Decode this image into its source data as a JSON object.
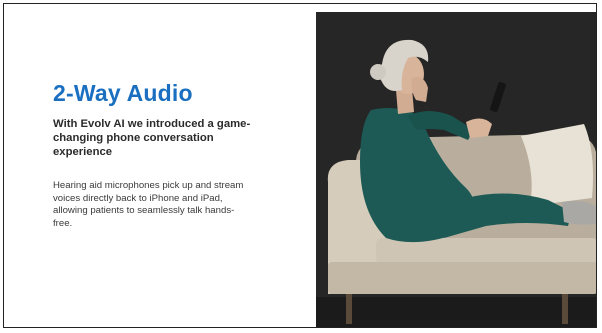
{
  "slide": {
    "title": "2-Way Audio",
    "subtitle": "With Evolv AI we introduced a game-changing phone conversation experience",
    "body": "Hearing aid microphones pick up and stream voices directly back to iPhone and iPad, allowing patients to seamlessly talk hands-free."
  },
  "colors": {
    "title": "#1a6fc0",
    "photo_background": "#262626",
    "sofa": "#cfc5b5",
    "outfit": "#1d5a55",
    "hair": "#d8d4cc"
  }
}
